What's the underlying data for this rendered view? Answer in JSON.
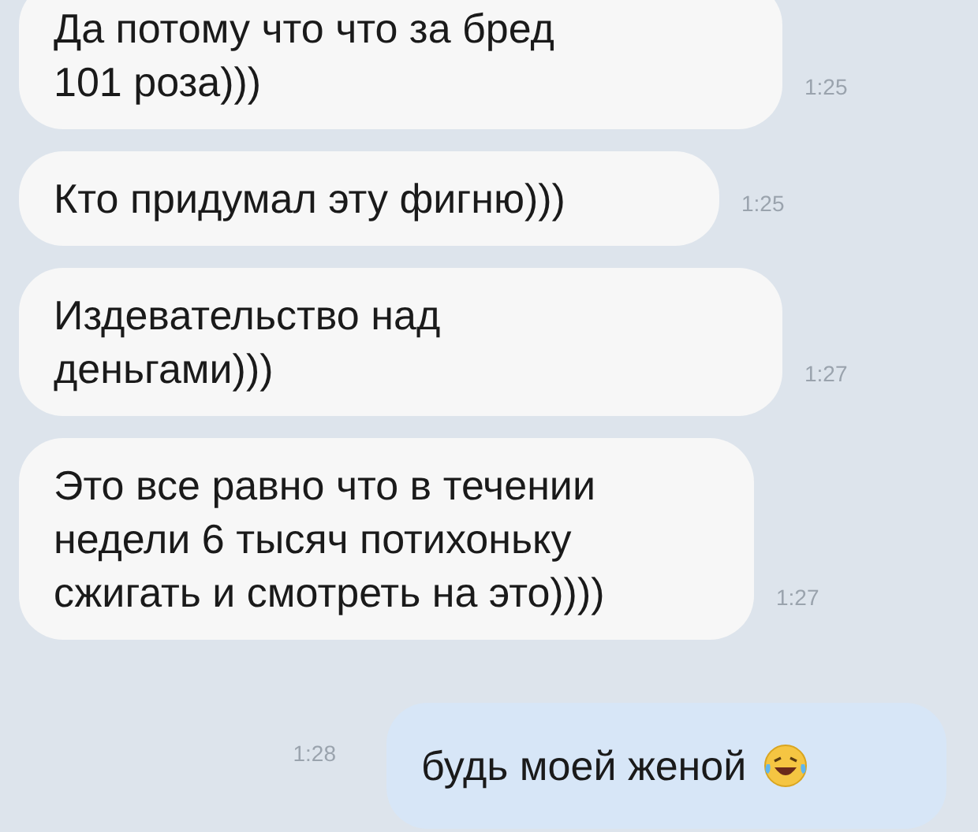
{
  "messages": [
    {
      "kind": "incoming",
      "text": "Да потому что что за бред\n101 роза)))",
      "time": "1:25"
    },
    {
      "kind": "incoming",
      "text": "Кто придумал эту фигню)))",
      "time": "1:25"
    },
    {
      "kind": "incoming",
      "text": "Издевательство над\nденьгами)))",
      "time": "1:27"
    },
    {
      "kind": "incoming",
      "text": "Это все равно что в течении\nнедели 6 тысяч потихоньку\nсжигать и смотреть на это))))",
      "time": "1:27"
    },
    {
      "kind": "outgoing",
      "text": "будь моей женой",
      "time": "1:28",
      "emoji": true
    }
  ]
}
